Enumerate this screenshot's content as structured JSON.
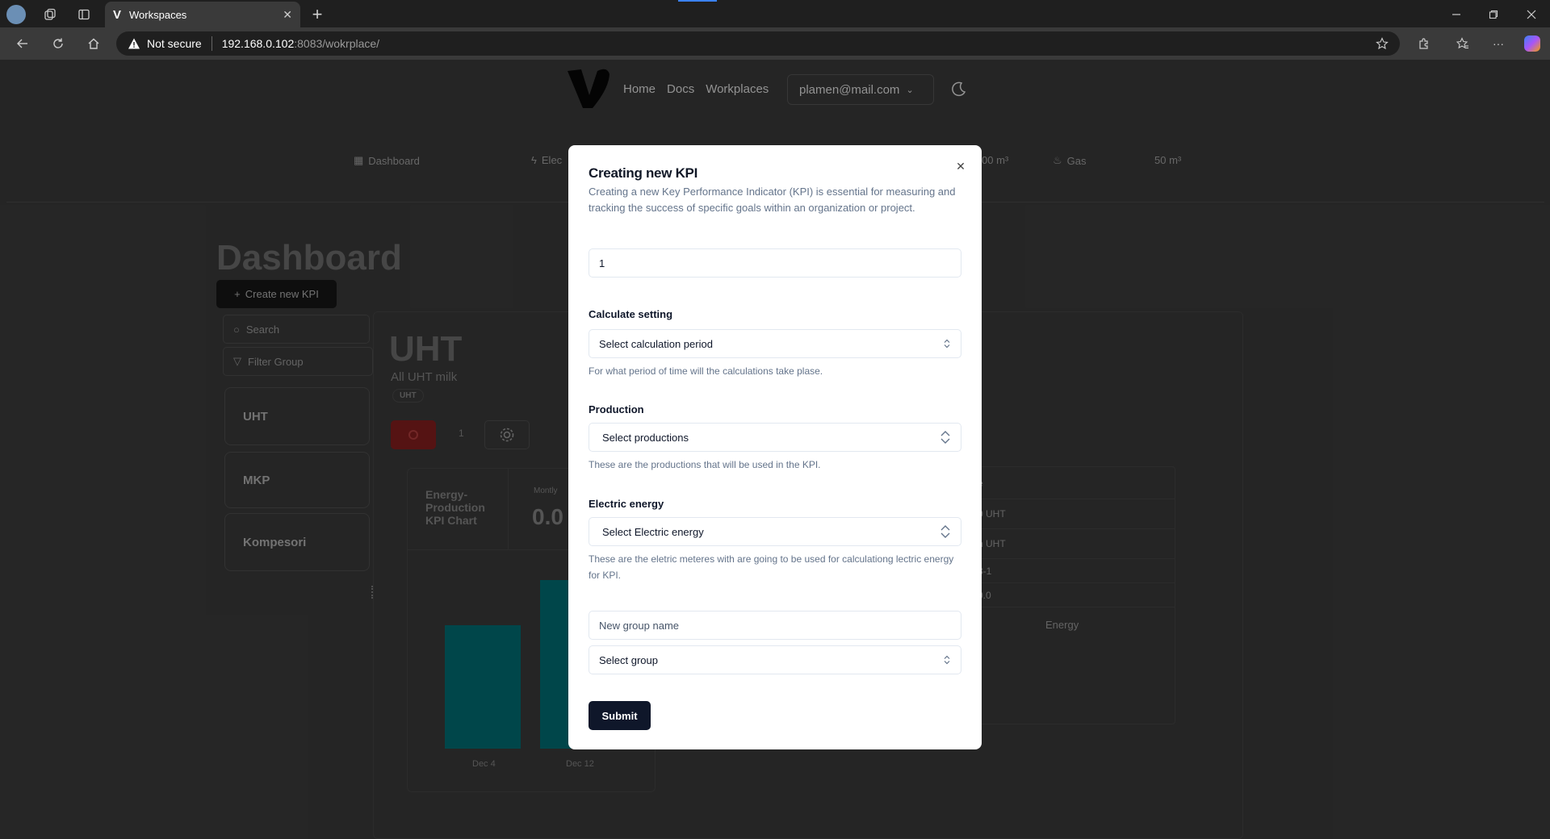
{
  "browser": {
    "tab_title": "Workspaces",
    "security_label": "Not secure",
    "url_host": "192.168.0.102",
    "url_path": ":8083/wokrplace/"
  },
  "nav": {
    "links": [
      "Home",
      "Docs",
      "Workplaces"
    ],
    "user_email": "plamen@mail.com"
  },
  "metrics": {
    "dashboard": "Dashboard",
    "electric": "Elec",
    "water_value": "00 m³",
    "gas": "Gas",
    "gas_value": "50 m³"
  },
  "dashboard": {
    "title": "Dashboard",
    "create_button": "Create new KPI",
    "search_placeholder": "Search",
    "filter_label": "Filter Group",
    "groups": [
      "UHT",
      "MKP",
      "Kompesori"
    ]
  },
  "group_detail": {
    "title": "UHT",
    "subtitle": "All UHT milk",
    "badge": "UHT",
    "counter": "1",
    "chart_title": "Energy-Production KPI Chart",
    "monthly_label": "Montly",
    "monthly_value": "0.0",
    "x_labels": [
      "Dec 4",
      "Dec 12"
    ],
    "table_rows": [
      "e",
      "0 UHT",
      "n UHT",
      "3-1",
      "0.0"
    ],
    "energy_label": "Energy"
  },
  "modal": {
    "title": "Creating new KPI",
    "description": "Creating a new Key Performance Indicator (KPI) is essential for measuring and tracking the success of specific goals within an organization or project.",
    "name_value": "1",
    "calculate": {
      "label": "Calculate setting",
      "placeholder": "Select calculation period",
      "hint": "For what period of time will the calculations take plase."
    },
    "production": {
      "label": "Production",
      "placeholder": "Select productions",
      "hint": "These are the productions that will be used in the KPI."
    },
    "electric": {
      "label": "Electric energy",
      "placeholder": "Select Electric energy",
      "hint": "These are the eletric meteres with are going to be used for calculationg lectric energy for KPI."
    },
    "new_group_placeholder": "New group name",
    "select_group_placeholder": "Select group",
    "submit_label": "Submit",
    "close_icon": "close-icon"
  }
}
